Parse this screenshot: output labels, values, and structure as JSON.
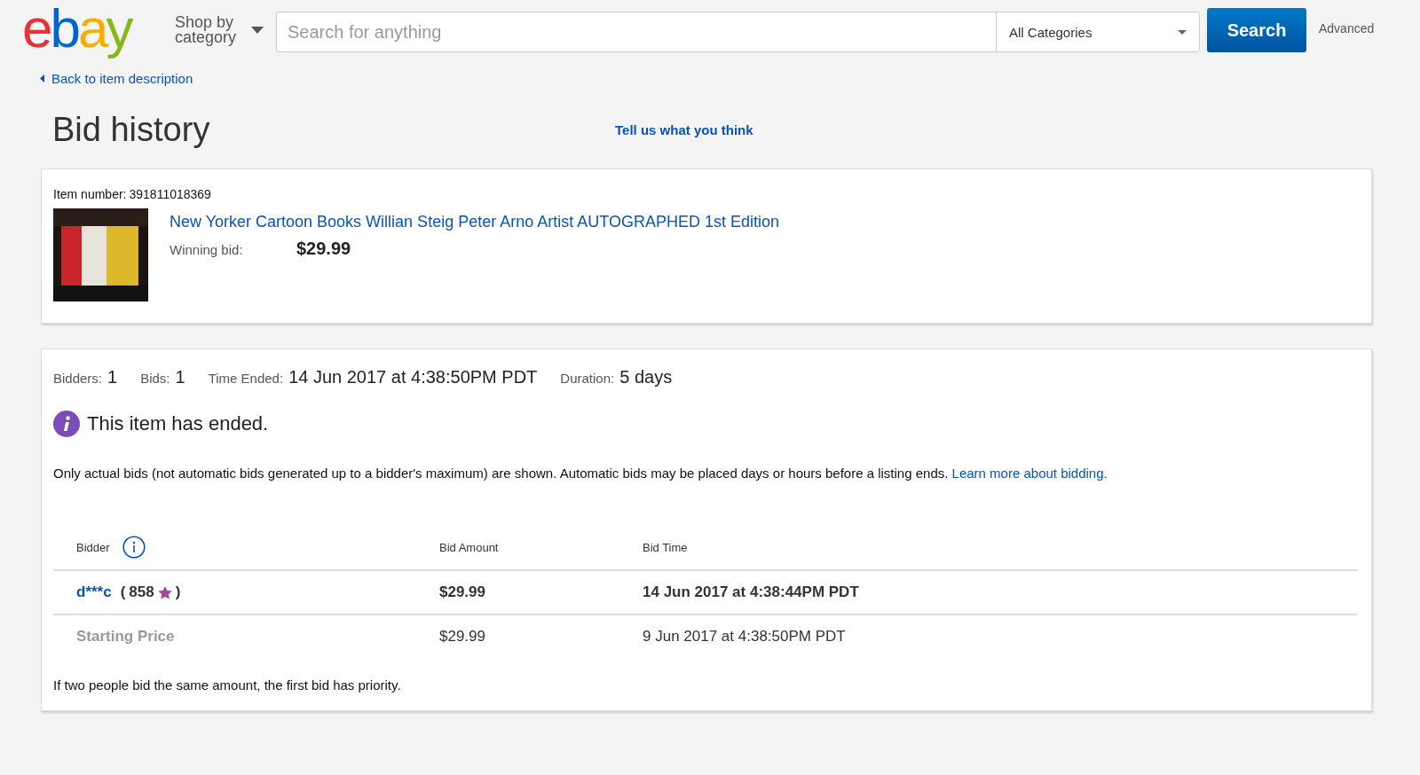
{
  "header": {
    "logo": "ebay",
    "shop_by": "Shop by category",
    "search": {
      "placeholder": "Search for anything"
    },
    "category": "All Categories",
    "search_button": "Search",
    "advanced": "Advanced"
  },
  "back_link": "Back to item description",
  "title": "Bid history",
  "feedback_link": "Tell us what you think",
  "item": {
    "number_label": "Item number:",
    "number": "391811018369",
    "title": "New Yorker Cartoon Books Willian Steig Peter Arno Artist AUTOGRAPHED 1st Edition",
    "winning_label": "Winning bid:",
    "winning_bid": "$29.99"
  },
  "summary": [
    {
      "label": "Bidders:",
      "value": "1"
    },
    {
      "label": "Bids:",
      "value": "1"
    },
    {
      "label": "Time Ended:",
      "value": "14 Jun 2017 at 4:38:50PM PDT"
    },
    {
      "label": "Duration:",
      "value": "5 days"
    }
  ],
  "notice": "This item has ended.",
  "info_text": "Only actual bids (not automatic bids generated up to a bidder's maximum) are shown. Automatic bids may be placed days or hours before a listing ends.",
  "info_link": "Learn more about bidding.",
  "table": {
    "columns": [
      "Bidder",
      "Bid Amount",
      "Bid Time"
    ],
    "rows": [
      {
        "kind": "bid",
        "bidder": "d***c",
        "feedback_open": "(",
        "feedback": "858",
        "feedback_close": ")",
        "amount": "$29.99",
        "time": "14 Jun 2017 at 4:38:44PM PDT"
      },
      {
        "kind": "starting",
        "bidder": "Starting Price",
        "amount": "$29.99",
        "time": "9 Jun 2017 at 4:38:50PM PDT"
      }
    ]
  },
  "footnote": "If two people bid the same amount, the first bid has priority."
}
